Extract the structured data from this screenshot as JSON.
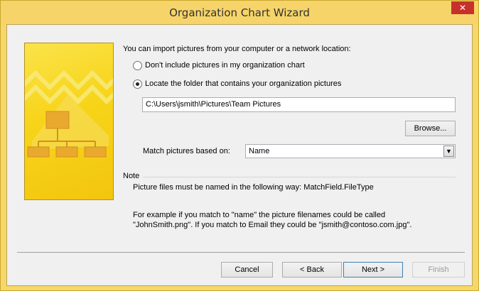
{
  "window": {
    "title": "Organization Chart Wizard",
    "close_glyph": "✕"
  },
  "content": {
    "intro": "You can import pictures from your computer or a network location:",
    "options": [
      {
        "label": "Don't include pictures in my organization chart",
        "checked": false
      },
      {
        "label": "Locate the folder that contains your organization pictures",
        "checked": true
      }
    ],
    "folder_path": "C:\\Users\\jsmith\\Pictures\\Team Pictures",
    "browse_label": "Browse...",
    "match_label": "Match pictures based on:",
    "match_value": "Name",
    "note_title": "Note",
    "note_text": "Picture files must be named in the following way: MatchField.FileType",
    "example_line1": "For example if you match to \"name\" the picture filenames could be called",
    "example_line2": "\"JohnSmith.png\". If you match to Email they could be \"jsmith@contoso.com.jpg\"."
  },
  "footer": {
    "cancel": "Cancel",
    "back": "< Back",
    "next": "Next >",
    "finish": "Finish"
  },
  "colors": {
    "frame": "#f6d46a",
    "banner": "#f7d419",
    "close": "#c7312b"
  }
}
